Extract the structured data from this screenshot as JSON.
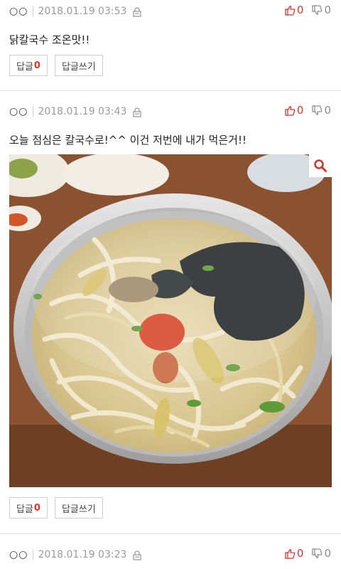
{
  "comments": [
    {
      "author": "○○",
      "date": "2018.01.19 03:53",
      "likes": "0",
      "dislikes": "0",
      "text": "닭칼국수 조온맛!!",
      "reply_label": "답글",
      "reply_count": "0",
      "write_reply_label": "답글쓰기"
    },
    {
      "author": "○○",
      "date": "2018.01.19 03:43",
      "likes": "0",
      "dislikes": "0",
      "text": "오늘 점심은 칼국수로!^^ 이건 저번에 내가 먹은거!!",
      "reply_label": "답글",
      "reply_count": "0",
      "write_reply_label": "답글쓰기"
    },
    {
      "author": "○○",
      "date": "2018.01.19 03:23",
      "likes": "0",
      "dislikes": "0"
    }
  ],
  "colors": {
    "accent_red": "#e0322d",
    "meta_gray": "#9a9a9a",
    "divider": "#dddddd"
  },
  "icons": {
    "lock": "lock-icon",
    "thumbs_up": "thumbs-up-icon",
    "thumbs_down": "thumbs-down-icon",
    "zoom": "magnifier-icon"
  }
}
